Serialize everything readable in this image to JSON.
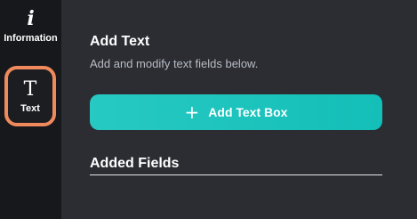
{
  "sidebar": {
    "items": [
      {
        "icon": "info-icon",
        "glyph": "i",
        "label": "Information",
        "active": false
      },
      {
        "icon": "text-icon",
        "glyph": "T",
        "label": "Text",
        "active": true
      }
    ]
  },
  "main": {
    "title": "Add Text",
    "subtitle": "Add and modify text fields below.",
    "add_button": {
      "icon": "plus-icon",
      "glyph": "+",
      "label": "Add Text Box"
    },
    "section_title": "Added Fields"
  },
  "colors": {
    "sidebar_bg": "#17181b",
    "panel_bg": "#2b2d33",
    "active_outline": "#f08a5d",
    "button_bg": "#1ec4bd"
  }
}
